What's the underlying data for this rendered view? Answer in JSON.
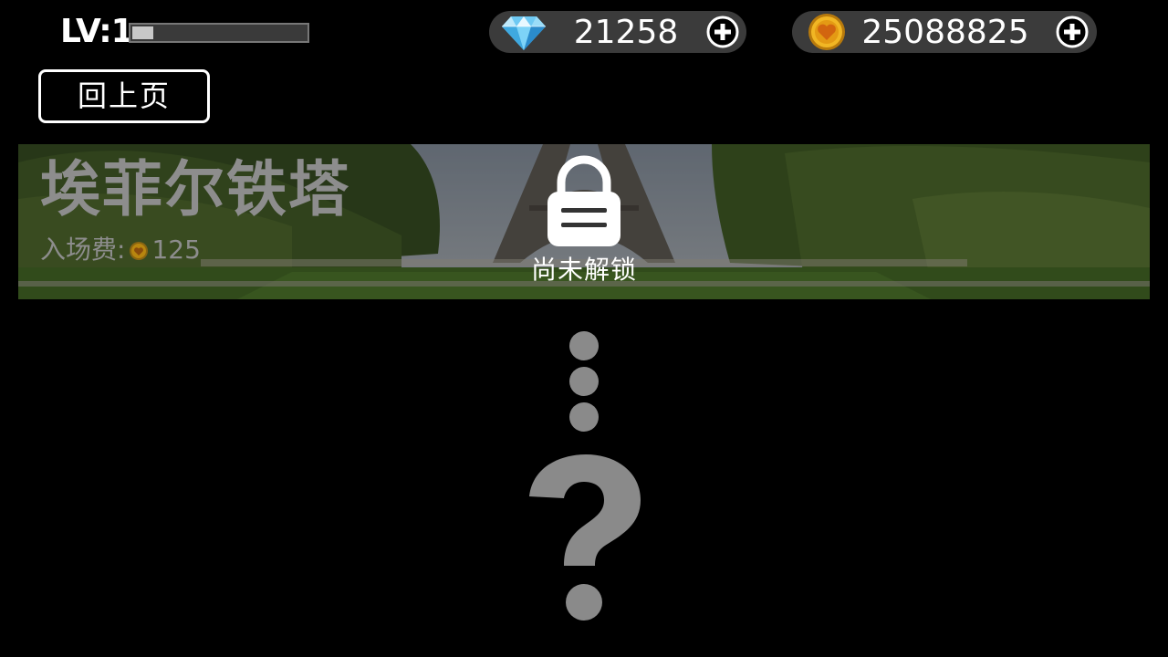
{
  "hud": {
    "level_label": "LV:1",
    "xp_progress": 0.12,
    "gems": "21258",
    "coins": "25088825",
    "gem_icon": "diamond-icon",
    "coin_icon": "heart-coin-icon",
    "add_icon": "plus-circle-icon"
  },
  "nav": {
    "back_label": "回上页"
  },
  "stage": {
    "name": "埃菲尔铁塔",
    "fee_label": "入场费:",
    "fee_value": "125",
    "lock_status": "尚未解锁",
    "lock_icon": "padlock-icon"
  },
  "placeholder": {
    "dots_icon": "vertical-ellipsis-icon",
    "question_mark": "question-mark-icon"
  },
  "colors": {
    "background": "#000000",
    "pill": "#3b3b3b",
    "locked_text": "#8d8d8d",
    "placeholder": "#8a8a8a",
    "coin_gold": "#e2a417"
  }
}
